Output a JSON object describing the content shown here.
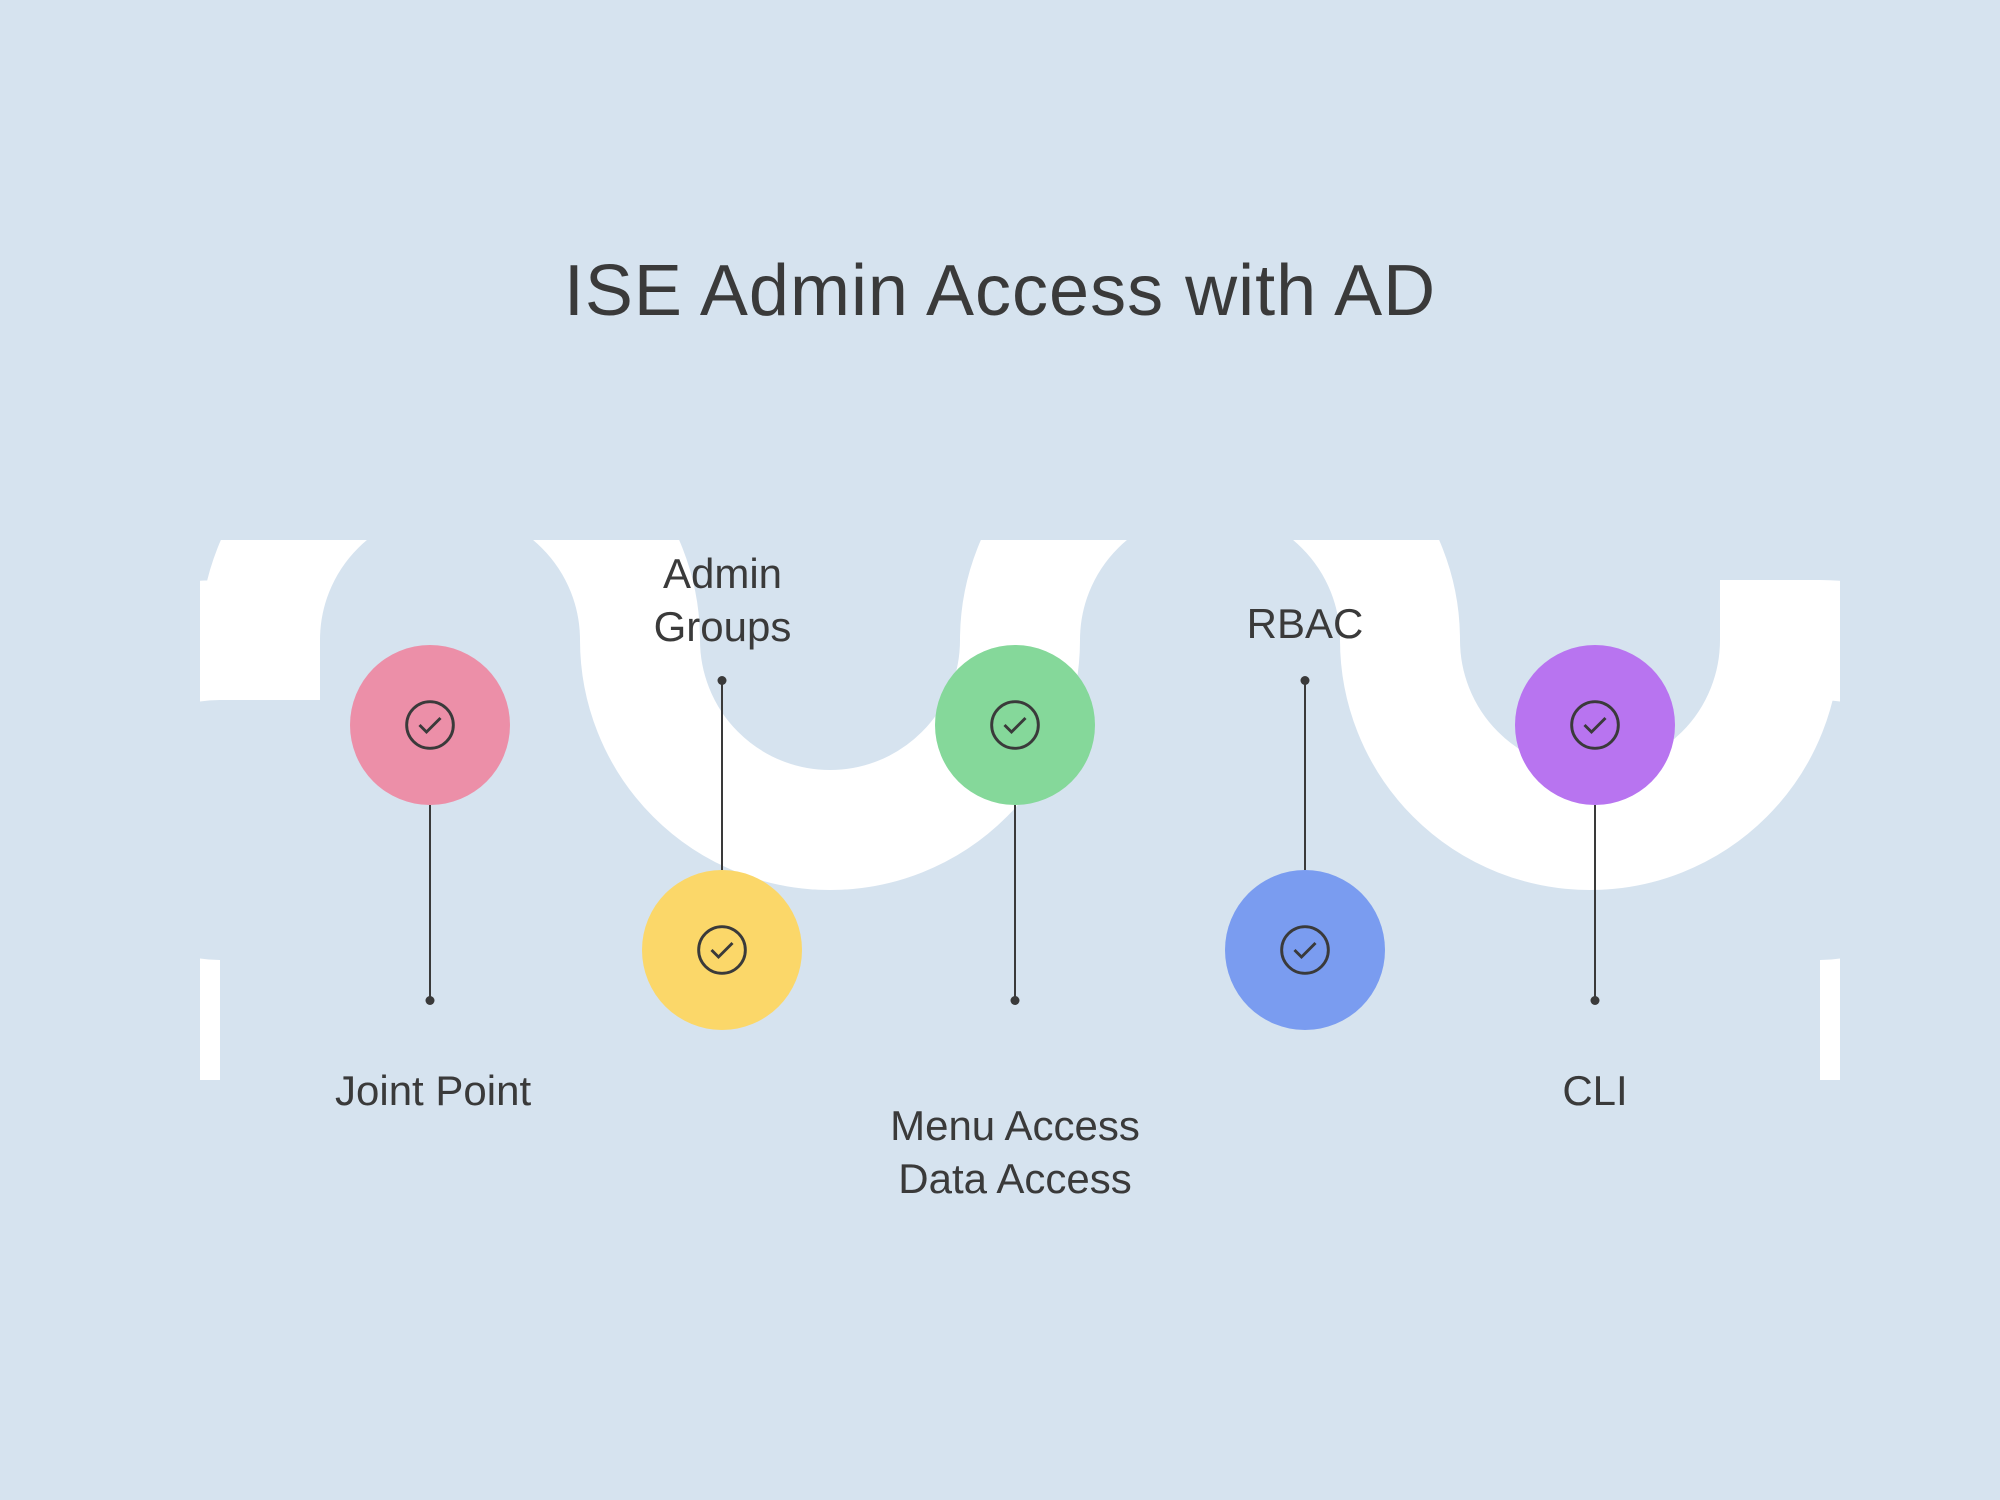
{
  "title": "ISE Admin Access with AD",
  "colors": {
    "bg": "#d6e3ef",
    "wave": "#ffffff",
    "text": "#3a3a3a"
  },
  "nodes": [
    {
      "label": "Joint Point",
      "color": "#ec8fa8",
      "label_position": "below"
    },
    {
      "label": "Admin\nGroups",
      "color": "#fbd769",
      "label_position": "above"
    },
    {
      "label": "Menu Access\nData Access",
      "color": "#85d89a",
      "label_position": "below"
    },
    {
      "label": "RBAC",
      "color": "#7a9cf0",
      "label_position": "above"
    },
    {
      "label": "CLI",
      "color": "#b874f0",
      "label_position": "below"
    }
  ]
}
